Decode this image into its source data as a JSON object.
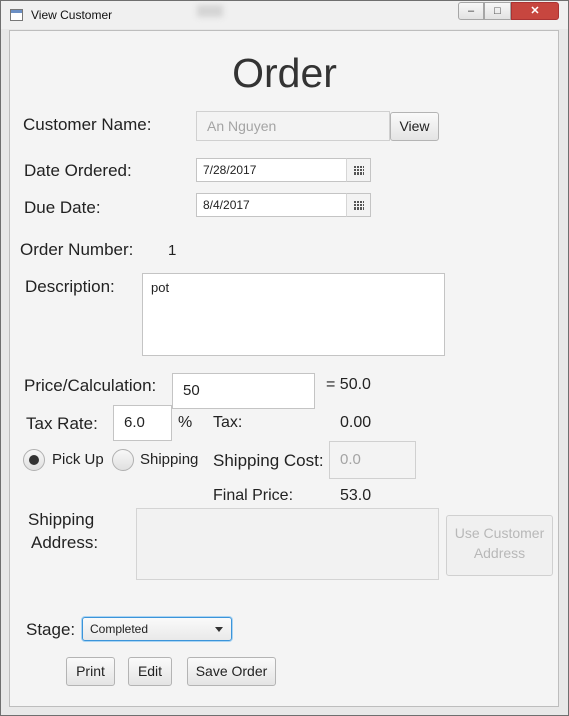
{
  "window": {
    "title": "View Customer",
    "minimize": "–",
    "maximize": "□",
    "close": "✕"
  },
  "heading": "Order",
  "customer": {
    "label": "Customer Name:",
    "value": "An Nguyen",
    "view_button": "View"
  },
  "date_ordered": {
    "label": "Date Ordered:",
    "value": "7/28/2017"
  },
  "due_date": {
    "label": "Due Date:",
    "value": "8/4/2017"
  },
  "order_number": {
    "label": "Order Number:",
    "value": "1"
  },
  "description": {
    "label": "Description:",
    "value": "pot"
  },
  "price": {
    "label": "Price/Calculation:",
    "value": "50",
    "result": "= 50.0"
  },
  "tax_rate": {
    "label": "Tax Rate:",
    "value": "6.0",
    "unit": "%"
  },
  "tax": {
    "label": "Tax:",
    "value": "0.00"
  },
  "delivery": {
    "pickup_label": "Pick Up",
    "shipping_label": "Shipping",
    "selected": "Pick Up"
  },
  "shipping_cost": {
    "label": "Shipping Cost:",
    "placeholder": "0.0"
  },
  "final_price": {
    "label": "Final Price:",
    "value": "53.0"
  },
  "shipping_address": {
    "label_line1": "Shipping",
    "label_line2": "Address:",
    "use_customer_line1": "Use Customer",
    "use_customer_line2": "Address"
  },
  "stage": {
    "label": "Stage:",
    "value": "Completed"
  },
  "actions": {
    "print": "Print",
    "edit": "Edit",
    "save": "Save Order"
  }
}
